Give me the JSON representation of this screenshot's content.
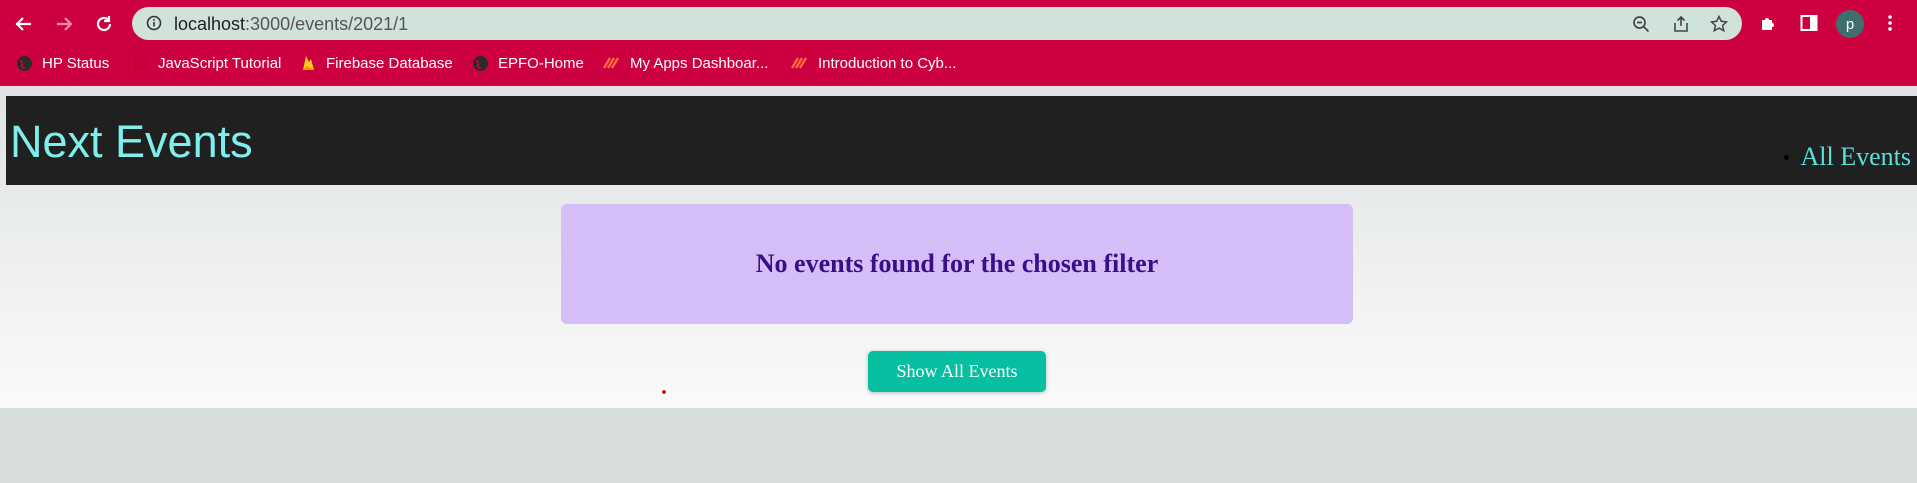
{
  "browser": {
    "url_host": "localhost",
    "url_path": ":3000/events/2021/1",
    "profile_initial": "p",
    "bookmarks": [
      {
        "label": "HP Status",
        "icon": "globe-icon"
      },
      {
        "label": "JavaScript Tutorial",
        "icon": "js-icon"
      },
      {
        "label": "Firebase Database",
        "icon": "firebase-icon"
      },
      {
        "label": "EPFO-Home",
        "icon": "globe-icon"
      },
      {
        "label": "My Apps Dashboar...",
        "icon": "apps-icon"
      },
      {
        "label": "Introduction to Cyb...",
        "icon": "apps-icon"
      }
    ]
  },
  "header": {
    "logo": "Next Events",
    "nav": [
      {
        "label": "All Events"
      }
    ]
  },
  "main": {
    "notice": "No events found for the chosen filter",
    "show_all_label": "Show All Events"
  },
  "colors": {
    "chrome": "#cd0040",
    "header_bg": "#202020",
    "logo": "#7df0ec",
    "notice_bg": "#d5bdf8",
    "notice_text": "#3a0e87",
    "button": "#05bfa0"
  }
}
